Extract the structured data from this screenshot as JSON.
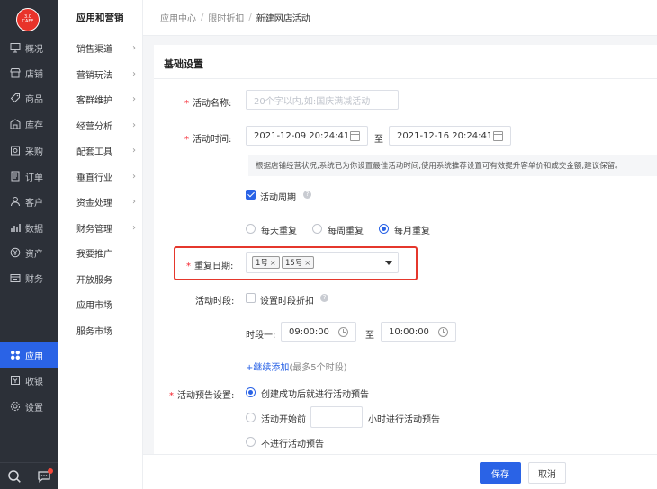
{
  "rail": {
    "logo_top": "3.0",
    "logo_bottom": "CAFE",
    "items": [
      {
        "label": "概况",
        "icon": "monitor-icon"
      },
      {
        "label": "店铺",
        "icon": "store-icon"
      },
      {
        "label": "商品",
        "icon": "tag-icon"
      },
      {
        "label": "库存",
        "icon": "warehouse-icon"
      },
      {
        "label": "采购",
        "icon": "purchase-icon"
      },
      {
        "label": "订单",
        "icon": "order-icon"
      },
      {
        "label": "客户",
        "icon": "user-icon"
      },
      {
        "label": "数据",
        "icon": "chart-icon"
      },
      {
        "label": "资产",
        "icon": "coin-icon"
      },
      {
        "label": "财务",
        "icon": "finance-icon"
      }
    ],
    "bottom_items": [
      {
        "label": "应用",
        "icon": "apps-icon",
        "active": true
      },
      {
        "label": "收银",
        "icon": "cashier-icon"
      },
      {
        "label": "设置",
        "icon": "gear-icon"
      }
    ]
  },
  "submenu": {
    "title": "应用和营销",
    "items": [
      {
        "label": "销售渠道",
        "arrow": true
      },
      {
        "label": "营销玩法",
        "arrow": true
      },
      {
        "label": "客群维护",
        "arrow": true
      },
      {
        "label": "经营分析",
        "arrow": true
      },
      {
        "label": "配套工具",
        "arrow": true
      },
      {
        "label": "垂直行业",
        "arrow": true
      },
      {
        "label": "资金处理",
        "arrow": true
      },
      {
        "label": "财务管理",
        "arrow": true
      },
      {
        "label": "我要推广",
        "arrow": false
      },
      {
        "label": "开放服务",
        "arrow": false
      },
      {
        "label": "应用市场",
        "arrow": false
      },
      {
        "label": "服务市场",
        "arrow": false
      }
    ]
  },
  "breadcrumb": [
    "应用中心",
    "限时折扣",
    "新建网店活动"
  ],
  "form": {
    "section_title": "基础设置",
    "name_label": "活动名称:",
    "name_placeholder": "20个字以内,如:国庆满减活动",
    "time_label": "活动时间:",
    "start_time": "2021-12-09 20:24:41",
    "to_text": "至",
    "end_time": "2021-12-16 20:24:41",
    "hint": "根据店铺经营状况,系统已为你设置最佳活动时间,使用系统推荐设置可有效提升客单价和成交金额,建议保留。",
    "cycle_label": "活动周期",
    "cycle_checked": true,
    "repeat_options": [
      "每天重复",
      "每周重复",
      "每月重复"
    ],
    "repeat_selected": 2,
    "repeat_date_label": "重复日期:",
    "repeat_tags": [
      "1号",
      "15号"
    ],
    "period_label": "活动时段:",
    "period_option": "设置时段折扣",
    "slot_label": "时段一:",
    "slot_start": "09:00:00",
    "slot_to": "至",
    "slot_end": "10:00:00",
    "add_link": "+继续添加",
    "add_hint": "(最多5个时段)",
    "preview_label": "活动预告设置:",
    "preview_options": {
      "opt1": "创建成功后就进行活动预告",
      "opt2_prefix": "活动开始前",
      "opt2_suffix": "小时进行活动预告",
      "opt3": "不进行活动预告"
    }
  },
  "buttons": {
    "save": "保存",
    "cancel": "取消"
  }
}
